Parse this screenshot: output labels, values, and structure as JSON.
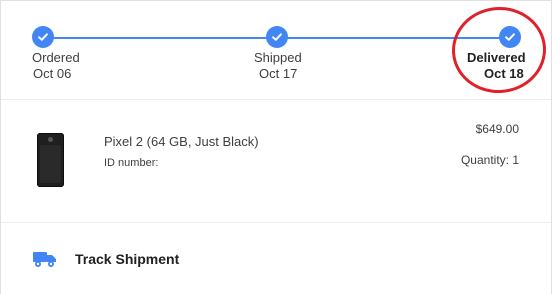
{
  "tracker": {
    "steps": [
      {
        "label": "Ordered",
        "date": "Oct 06"
      },
      {
        "label": "Shipped",
        "date": "Oct 17"
      },
      {
        "label": "Delivered",
        "date": "Oct 18"
      }
    ],
    "accent_color": "#4285f4",
    "highlight_color": "#e0202a"
  },
  "item": {
    "name": "Pixel 2 (64 GB, Just Black)",
    "id_label": "ID number:",
    "price": "$649.00",
    "quantity": "Quantity: 1",
    "image_icon": "phone-image"
  },
  "shipment": {
    "label": "Track Shipment",
    "icon": "truck-icon"
  }
}
